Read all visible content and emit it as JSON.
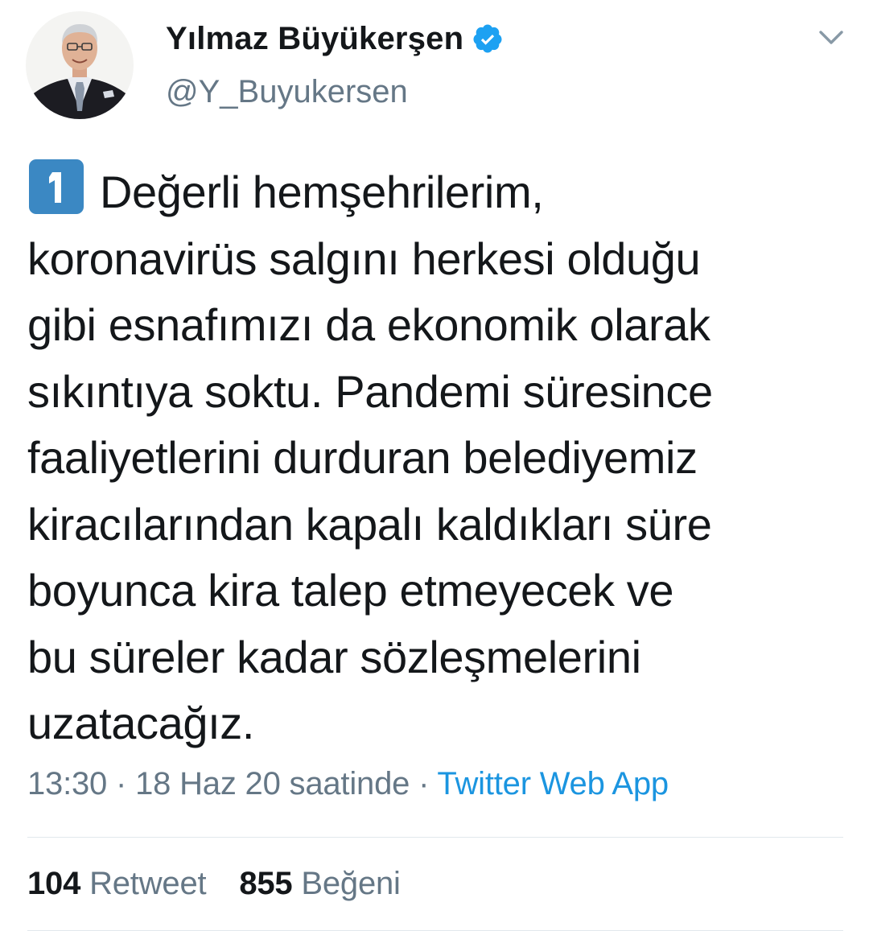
{
  "author": {
    "display_name": "Yılmaz Büyükerşen",
    "handle": "@Y_Buyukersen",
    "verified": true,
    "avatar_icon": "profile-photo",
    "verified_icon": "verified-badge-icon"
  },
  "menu": {
    "icon": "chevron-down-icon"
  },
  "tweet": {
    "emoji": "keycap-1",
    "lines": [
      "Değerli hemşehrilerim,",
      "koronavirüs salgını herkesi olduğu",
      "gibi esnafımızı da ekonomik olarak",
      "sıkıntıya soktu. Pandemi süresince",
      "faaliyetlerini durduran belediyemiz",
      "kiracılarından kapalı kaldıkları süre",
      "boyunca kira talep etmeyecek ve",
      "bu süreler kadar sözleşmelerini",
      "uzatacağız."
    ]
  },
  "meta": {
    "time": "13:30",
    "separator": "·",
    "date": "18 Haz 20 saatinde",
    "source": "Twitter Web App"
  },
  "stats": {
    "retweets": {
      "count": "104",
      "label": "Retweet"
    },
    "likes": {
      "count": "855",
      "label": "Beğeni"
    }
  },
  "colors": {
    "text": "#14171a",
    "secondary": "#657786",
    "link": "#1b95e0",
    "verified": "#1da1f2",
    "keycap": "#3b88c3",
    "divider": "#e1e8ed"
  }
}
